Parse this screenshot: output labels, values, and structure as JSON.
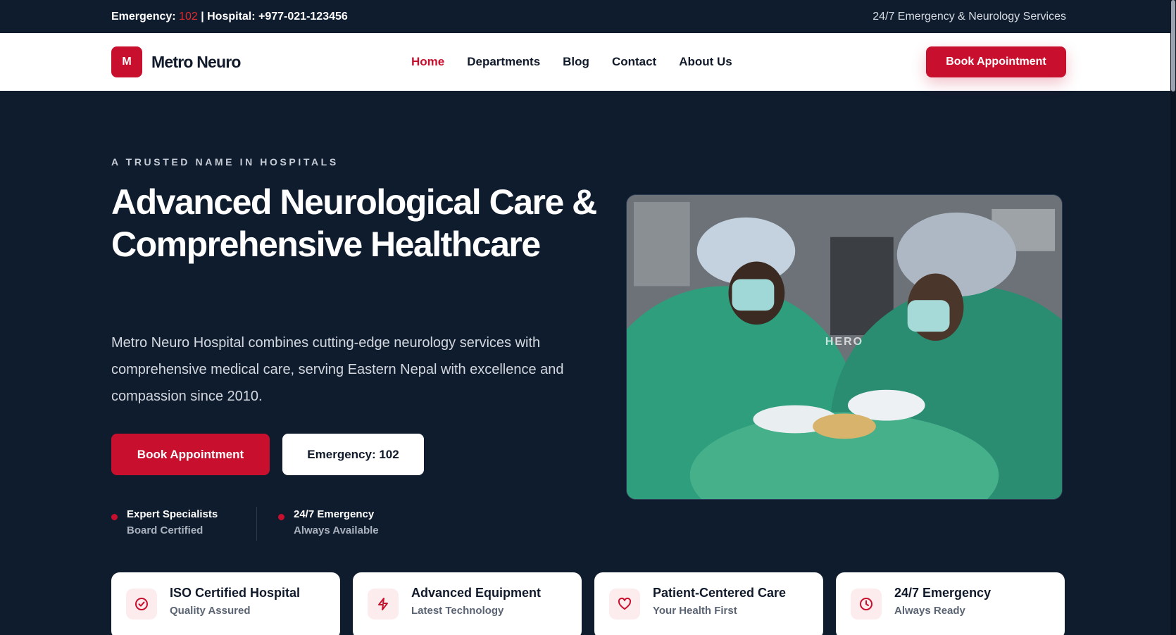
{
  "topbar": {
    "emergency_label": "Emergency:",
    "emergency_number": "102",
    "hospital_text": "| Hospital: +977-021-123456",
    "tagline": "24/7 Emergency & Neurology Services"
  },
  "nav": {
    "logo_letter": "M",
    "logo_text": "Metro Neuro",
    "items": [
      {
        "label": "Home",
        "active": true
      },
      {
        "label": "Departments"
      },
      {
        "label": "Blog"
      },
      {
        "label": "Contact"
      },
      {
        "label": "About Us"
      }
    ],
    "cta": "Book Appointment"
  },
  "hero": {
    "eyebrow": "A TRUSTED NAME IN HOSPITALS",
    "title": "Advanced Neurological Care & Comprehensive Healthcare",
    "description": "Metro Neuro Hospital combines cutting-edge neurology services with comprehensive medical care, serving Eastern Nepal with excellence and compassion since 2010.",
    "primary_button": "Book Appointment",
    "secondary_button": "Emergency: 102",
    "features": [
      {
        "title": "Expert Specialists",
        "subtitle": "Board Certified"
      },
      {
        "title": "24/7 Emergency",
        "subtitle": "Always Available"
      }
    ],
    "image_label": "HERO"
  },
  "cards": [
    {
      "icon": "check-circle-icon",
      "title": "ISO Certified Hospital",
      "subtitle": "Quality Assured"
    },
    {
      "icon": "lightning-icon",
      "title": "Advanced Equipment",
      "subtitle": "Latest Technology"
    },
    {
      "icon": "heart-icon",
      "title": "Patient-Centered Care",
      "subtitle": "Your Health First"
    },
    {
      "icon": "clock-icon",
      "title": "24/7 Emergency",
      "subtitle": "Always Ready"
    }
  ],
  "colors": {
    "brand_red": "#c8102e",
    "navy": "#0f1c2e"
  }
}
